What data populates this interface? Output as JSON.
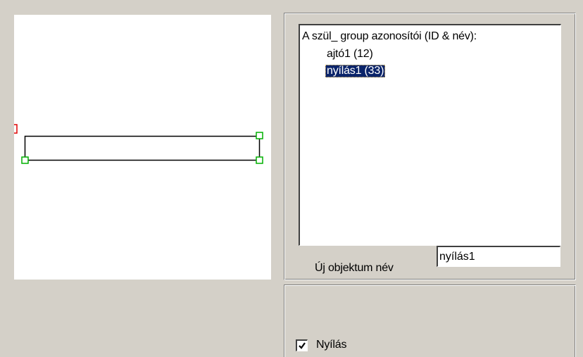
{
  "preview": {
    "shape_color": "#000000",
    "handle_color": "#00b000",
    "marker_color": "#e00000"
  },
  "listbox": {
    "header": "A szül_ group azonosítói (ID & név):",
    "items": [
      {
        "label": "ajtó1 (12)",
        "selected": false
      },
      {
        "label": "nyílás1 (33)",
        "selected": true
      }
    ]
  },
  "name_field": {
    "label": "Új objektum név",
    "value": "nyílás1"
  },
  "checkbox": {
    "label": "Nyílás",
    "checked": true
  },
  "colors": {
    "selection_bg": "#0a246a",
    "dialog_bg": "#d4d0c8"
  }
}
